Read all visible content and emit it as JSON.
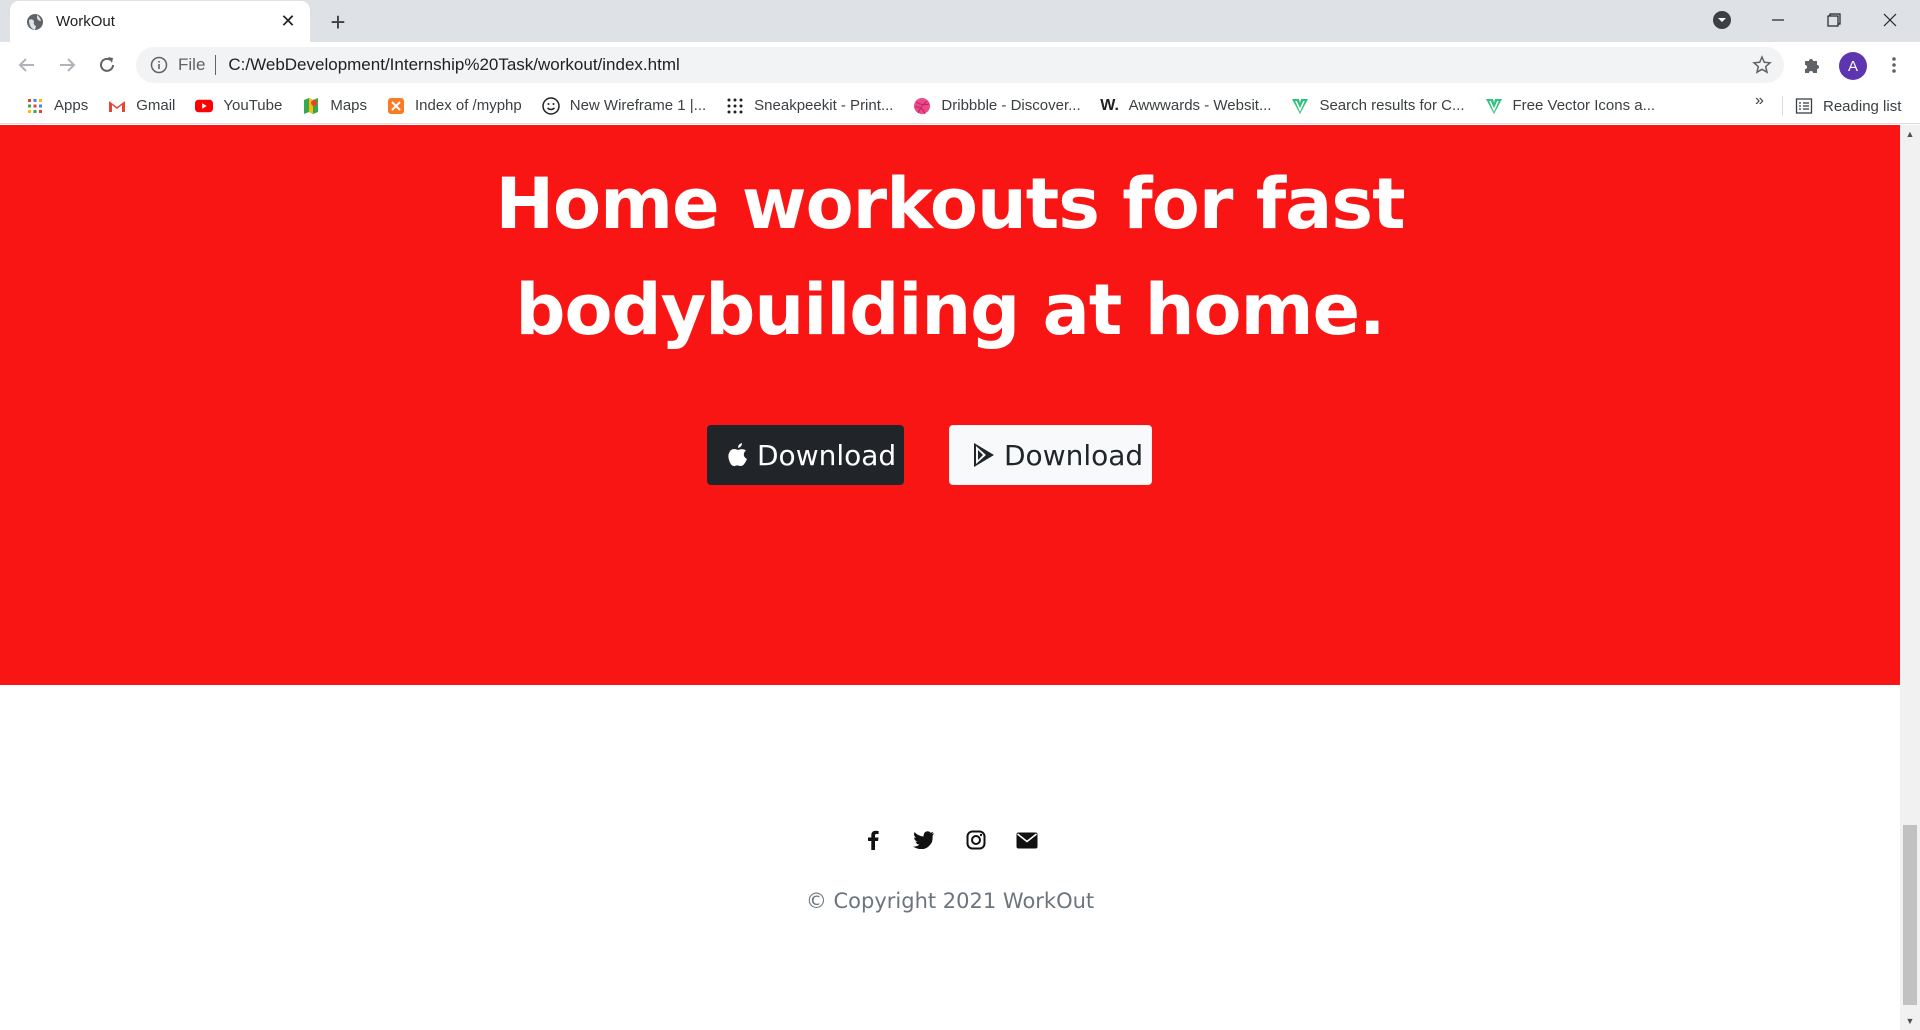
{
  "browser": {
    "tab_title": "WorkOut",
    "url_scheme": "File",
    "url": "C:/WebDevelopment/Internship%20Task/workout/index.html",
    "avatar_letter": "A",
    "bookmarks": [
      {
        "label": "Apps",
        "icon": "apps-grid-icon"
      },
      {
        "label": "Gmail",
        "icon": "gmail-icon"
      },
      {
        "label": "YouTube",
        "icon": "youtube-icon"
      },
      {
        "label": "Maps",
        "icon": "maps-icon"
      },
      {
        "label": "Index of /myphp",
        "icon": "xampp-icon"
      },
      {
        "label": "New Wireframe 1 |...",
        "icon": "smiley-icon"
      },
      {
        "label": "Sneakpeekit - Print...",
        "icon": "dots-grid-icon"
      },
      {
        "label": "Dribbble - Discover...",
        "icon": "dribbble-icon"
      },
      {
        "label": "Awwwards - Websit...",
        "icon": "awwwards-icon"
      },
      {
        "label": "Search results for C...",
        "icon": "vector-icon"
      },
      {
        "label": "Free Vector Icons a...",
        "icon": "vector-icon"
      }
    ],
    "bookmarks_more": "»",
    "reading_list": "Reading list"
  },
  "page": {
    "hero_title_line1": "Home workouts for fast",
    "hero_title_line2": "bodybuilding at home.",
    "apple_download_label": "Download",
    "play_download_label": "Download",
    "footer_icons": [
      "facebook-icon",
      "twitter-icon",
      "instagram-icon",
      "envelope-icon"
    ],
    "copyright": "© Copyright 2021 WorkOut"
  },
  "colors": {
    "hero_bg": "#fa1515",
    "apple_btn_bg": "#212529",
    "play_btn_bg": "#f8f9fa",
    "avatar_bg": "#5e35b1"
  }
}
